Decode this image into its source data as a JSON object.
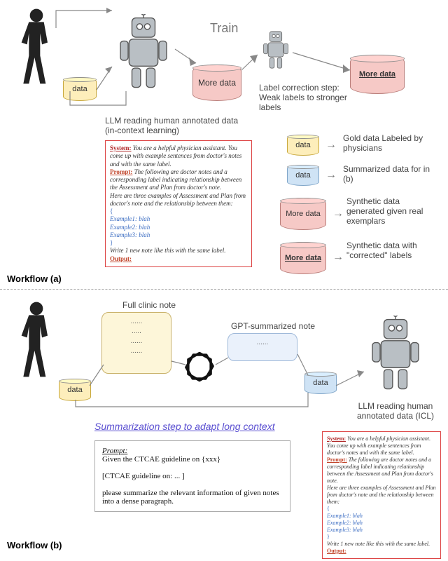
{
  "workflow_a": {
    "label": "Workflow (a)",
    "train_label": "Train",
    "data_cyl": "data",
    "more_data_cyl": "More data",
    "more_data_bold_cyl": "More data",
    "llm_caption": "LLM reading human annotated data (in-context learning)",
    "correction_caption": "Label correction step:\nWeak labels to stronger labels",
    "legend": {
      "gold": {
        "cyl": "data",
        "text": "Gold data Labeled by physicians"
      },
      "summ": {
        "cyl": "data",
        "text": "Summarized data for in (b)"
      },
      "syn": {
        "cyl": "More data",
        "text": "Synthetic data generated given real exemplars"
      },
      "corr": {
        "cyl": "More data",
        "text": "Synthetic data with \"corrected\" labels"
      }
    },
    "prompt": {
      "system_label": "System:",
      "system_text": " You are a helpful physician assistant. You come up with example sentences from doctor's notes and with the same label.",
      "prompt_label": "Prompt:",
      "prompt_text": " The following are doctor notes and a corresponding label indicating relationship between the Assessment and Plan from doctor's note.",
      "lead": "Here are three examples of Assessment and Plan from doctor's note and the relationship between them:",
      "ex1": "Example1: blah",
      "ex2": "Example2: blah",
      "ex3": "Example3: blah",
      "tail": "Write 1 new note like this with the same label.",
      "output_label": "Output:"
    }
  },
  "workflow_b": {
    "label": "Workflow (b)",
    "full_note_label": "Full clinic note",
    "gpt_note_label": "GPT-summarized note",
    "data_cyl1": "data",
    "data_cyl2": "data",
    "summ_link": "Summarization step to adapt long context",
    "llm_caption": "LLM reading human annotated data (ICL)",
    "note_dots": "......\n.....\n......\n......",
    "gpt_dots": "......",
    "ctcae_prompt": {
      "label": "Prompt:",
      "line1": "Given the CTCAE guideline on {xxx}",
      "line2": "[CTCAE guideline on:  ...  ]",
      "line3": "please summarize the relevant information of given notes into a dense paragraph."
    }
  }
}
